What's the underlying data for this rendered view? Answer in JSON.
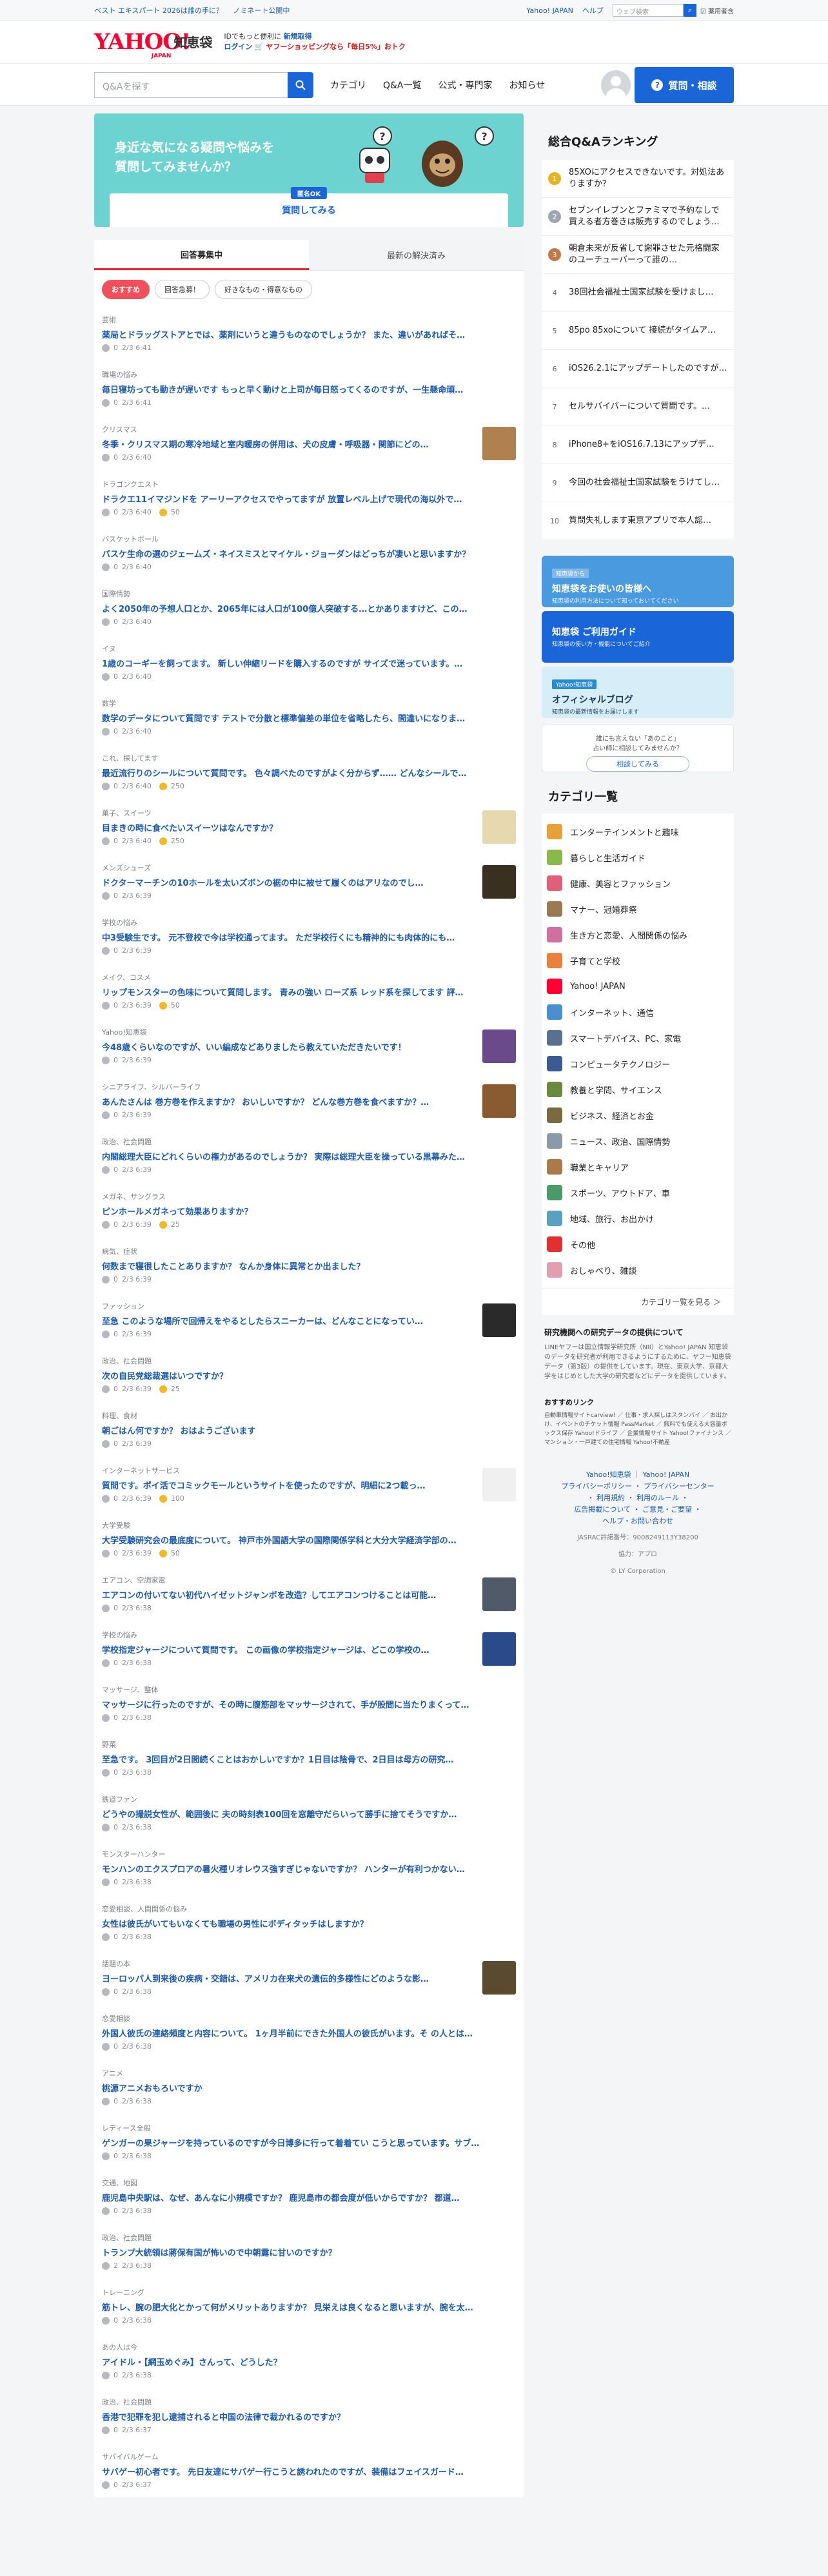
{
  "topbar": {
    "links": [
      "ベスト エキスパート 2026は誰の手に？",
      "ノミネート公開中"
    ],
    "right": [
      "Yahoo! JAPAN",
      "ヘルプ"
    ],
    "websearch_placeholder": "ウェブ検索",
    "websearch_scope": "☑ 薬用者含"
  },
  "header": {
    "logo": "YAHOO!",
    "logo_sub": "JAPAN",
    "service": "知恵袋",
    "promo_line1": "IDでもっと便利に",
    "promo_new": "新規取得",
    "promo_login": "ログイン",
    "promo_line2": "🛒 ヤフーショッピングなら「毎日5%」おトク"
  },
  "nav": {
    "search_placeholder": "Q&Aを探す",
    "links": [
      "カテゴリ",
      "Q&A一覧",
      "公式・専門家",
      "お知らせ"
    ],
    "ask_label": "質問・相談"
  },
  "banner": {
    "line1": "身近な気になる疑問や悩みを",
    "line2": "質問してみませんか？",
    "tag": "匿名OK",
    "button": "質問してみる"
  },
  "tabs": [
    "回答募集中",
    "最新の解決済み"
  ],
  "filters": [
    "おすすめ",
    "回答急募！",
    "好きなもの・得意なもの"
  ],
  "questions": [
    {
      "cat": "芸術",
      "title": "薬局とドラッグストアとでは、薬剤にいうと違うものなのでしょうか？ また、違いがあればそ…",
      "ans": "0",
      "time": "2/3 6:41",
      "coin": ""
    },
    {
      "cat": "職場の悩み",
      "title": "毎日寝坊っても動きが遅いです もっと早く動けと上司が毎日怒ってくるのですが、一生懸命頑…",
      "ans": "0",
      "time": "2/3 6:41",
      "coin": ""
    },
    {
      "cat": "クリスマス",
      "title": "冬季・クリスマス期の寒冷地域と室内暖房の併用は、犬の皮膚・呼吸器・関節にどの…",
      "ans": "0",
      "time": "2/3 6:40",
      "coin": "",
      "thumb": "#b08050"
    },
    {
      "cat": "ドラゴンクエスト",
      "title": "ドラクエ11イマジンドを アーリーアクセスでやってますが 放置レベル上げで現代の海以外で…",
      "ans": "0",
      "time": "2/3 6:40",
      "coin": "50"
    },
    {
      "cat": "バスケットボール",
      "title": "バスケ生命の選のジェームズ・ネイスミスとマイケル・ジョーダンはどっちが凄いと思いますか？",
      "ans": "0",
      "time": "2/3 6:40",
      "coin": ""
    },
    {
      "cat": "国際情勢",
      "title": "よく2050年の予想人口とか、2065年には人口が100億人突破する…とかありますけど、この…",
      "ans": "0",
      "time": "2/3 6:40",
      "coin": ""
    },
    {
      "cat": "イヌ",
      "title": "1歳のコーギーを飼ってます。 新しい伸縮リードを購入するのですが サイズで迷っています。…",
      "ans": "0",
      "time": "2/3 6:40",
      "coin": ""
    },
    {
      "cat": "数学",
      "title": "数学のデータについて質問です テストで分散と標準偏差の単位を省略したら、間違いになりま…",
      "ans": "0",
      "time": "2/3 6:40",
      "coin": ""
    },
    {
      "cat": "これ、探してます",
      "title": "最近流行りのシールについて質問です。 色々調べたのですがよく分からず…… どんなシールで…",
      "ans": "0",
      "time": "2/3 6:40",
      "coin": "250"
    },
    {
      "cat": "菓子、スイーツ",
      "title": "目まきの時に食べたいスイーツはなんですか？",
      "ans": "0",
      "time": "2/3 6:40",
      "coin": "250",
      "thumb": "#e8d8b0"
    },
    {
      "cat": "メンズシューズ",
      "title": "ドクターマーチンの10ホールを太いズボンの裾の中に被せて履くのはアリなのでし…",
      "ans": "0",
      "time": "2/3 6:39",
      "coin": "",
      "thumb": "#3a3020"
    },
    {
      "cat": "学校の悩み",
      "title": "中3受験生です。 元不登校で今は学校通ってます。 ただ学校行くにも精神的にも肉体的にも…",
      "ans": "0",
      "time": "2/3 6:39",
      "coin": ""
    },
    {
      "cat": "メイク、コスメ",
      "title": "リップモンスターの色味について質問します。 青みの強い ローズ系 レッド系を探してます 評…",
      "ans": "0",
      "time": "2/3 6:39",
      "coin": "50"
    },
    {
      "cat": "Yahoo!知恵袋",
      "title": "今48歳くらいなのですが、いい編成などありましたら教えていただきたいです！",
      "ans": "0",
      "time": "2/3 6:39",
      "coin": "",
      "thumb": "#6a4a8a"
    },
    {
      "cat": "シニアライフ、シルバーライフ",
      "title": "あんたさんは 巻方巻を作えますか？ おいしいですか？ どんな巻方巻を食べますか？…",
      "ans": "0",
      "time": "2/3 6:39",
      "coin": "",
      "thumb": "#8a5a30"
    },
    {
      "cat": "政治、社会問題",
      "title": "内閣総理大臣にどれくらいの権力があるのでしょうか？ 実際は総理大臣を操っている黒幕みた…",
      "ans": "0",
      "time": "2/3 6:39",
      "coin": ""
    },
    {
      "cat": "メガネ、サングラス",
      "title": "ピンホールメガネって効果ありますか？",
      "ans": "0",
      "time": "2/3 6:39",
      "coin": "25"
    },
    {
      "cat": "病気、症状",
      "title": "何数まで寝很したことありますか？ なんか身体に異常とか出ました？",
      "ans": "0",
      "time": "2/3 6:39",
      "coin": ""
    },
    {
      "cat": "ファッション",
      "title": "至急 このような場所で回帰えをやるとしたらスニーカーは、どんなことになってい…",
      "ans": "0",
      "time": "2/3 6:39",
      "coin": "",
      "thumb": "#2a2a2a"
    },
    {
      "cat": "政治、社会問題",
      "title": "次の自民党総裁選はいつですか？",
      "ans": "0",
      "time": "2/3 6:39",
      "coin": "25"
    },
    {
      "cat": "料理、食材",
      "title": "朝ごはん何ですか？ おはようございます",
      "ans": "0",
      "time": "2/3 6:39",
      "coin": ""
    },
    {
      "cat": "インターネットサービス",
      "title": "質問です。ポイ活でコミックモールというサイトを使ったのですが、明細に2つ載っ…",
      "ans": "0",
      "time": "2/3 6:39",
      "coin": "100",
      "thumb": "#f0f0f0"
    },
    {
      "cat": "大学受験",
      "title": "大学受験研究会の最底度について。 神戸市外国語大学の国際関係学科と大分大学経済学部の…",
      "ans": "0",
      "time": "2/3 6:39",
      "coin": "50"
    },
    {
      "cat": "エアコン、空調家電",
      "title": "エアコンの付いてない初代ハイゼットジャンボを改造？してエアコンつけることは可能…",
      "ans": "0",
      "time": "2/3 6:38",
      "coin": "",
      "thumb": "#505a68"
    },
    {
      "cat": "学校の悩み",
      "title": "学校指定ジャージについて質問です。 この画像の学校指定ジャージは、どこの学校の…",
      "ans": "0",
      "time": "2/3 6:38",
      "coin": "",
      "thumb": "#2a4a8a"
    },
    {
      "cat": "マッサージ、整体",
      "title": "マッサージに行ったのですが、その時に腹筋部をマッサージされて、手が股間に当たりまくって…",
      "ans": "0",
      "time": "2/3 6:38",
      "coin": ""
    },
    {
      "cat": "野菜",
      "title": "至急です。 3回目が2日間続くことはおかしいですか？1日目は陰骨で、2日目は母方の研究…",
      "ans": "0",
      "time": "2/3 6:38",
      "coin": ""
    },
    {
      "cat": "鉄道ファン",
      "title": "どうやの撮説女性が、範囲後に 夫の時刻表100回を窓離守だらいって勝手に捨てそうですか…",
      "ans": "0",
      "time": "2/3 6:38",
      "coin": ""
    },
    {
      "cat": "モンスターハンター",
      "title": "モンハンのエクスプロアの暑火種リオレウス強すぎじゃないですか？ ハンターが有利つかない…",
      "ans": "0",
      "time": "2/3 6:38",
      "coin": ""
    },
    {
      "cat": "恋愛相談、人間関係の悩み",
      "title": "女性は彼氏がいてもいなくても職場の男性にボディタッチはしますか？",
      "ans": "0",
      "time": "2/3 6:38",
      "coin": ""
    },
    {
      "cat": "話題の本",
      "title": "ヨーロッパ人到来後の疾病・交錯は、アメリカ在来犬の遺伝的多様性にどのような影…",
      "ans": "0",
      "time": "2/3 6:38",
      "coin": "",
      "thumb": "#5a4a30"
    },
    {
      "cat": "恋愛相談",
      "title": "外国人彼氏の連絡頻度と内容について。 1ヶ月半前にできた外国人の彼氏がいます。そ の人とは…",
      "ans": "0",
      "time": "2/3 6:38",
      "coin": ""
    },
    {
      "cat": "アニメ",
      "title": "桃源アニメおもろいですか",
      "ans": "0",
      "time": "2/3 6:38",
      "coin": ""
    },
    {
      "cat": "レディース全般",
      "title": "ゲンガーの果ジャージを持っているのですが今日博多に行って着着てい こうと思っています。サブ…",
      "ans": "0",
      "time": "2/3 6:38",
      "coin": ""
    },
    {
      "cat": "交通、地図",
      "title": "鹿児島中央駅は、なぜ、あんなに小規模ですか？ 鹿児島市の都会度が低いからですか？ 都道…",
      "ans": "0",
      "time": "2/3 6:38",
      "coin": ""
    },
    {
      "cat": "政治、社会問題",
      "title": "トランプ大統領は蔣保有国が怖いので中朝露に甘いのですか？",
      "ans": "2",
      "time": "2/3 6:38",
      "coin": ""
    },
    {
      "cat": "トレーニング",
      "title": "筋トレ、腕の肥大化とかって何がメリットありますか？ 見栄えは良くなると思いますが、腕を太…",
      "ans": "0",
      "time": "2/3 6:38",
      "coin": ""
    },
    {
      "cat": "あの人は今",
      "title": "アイドル・【網玉めぐみ】さんって、どうした？",
      "ans": "0",
      "time": "2/3 6:38",
      "coin": ""
    },
    {
      "cat": "政治、社会問題",
      "title": "香港で犯罪を犯し逮捕されると中国の法律で裁かれるのですか？",
      "ans": "0",
      "time": "2/3 6:37",
      "coin": ""
    },
    {
      "cat": "サバイバルゲーム",
      "title": "サバゲー初心者です。 先日友達にサバゲー行こうと誘われたのですが、装備はフェイスガード…",
      "ans": "0",
      "time": "2/3 6:37",
      "coin": ""
    }
  ],
  "ranking": {
    "title": "総合Q&Aランキング",
    "items": [
      "85XOにアクセスできないです。対処法ありますか？",
      "セブンイレブンとファミマで予約なしで買える者方巻きは販売するのでしょうか？",
      "朝倉未来が反省して謝罪させた元格闘家のユーチューバーって誰の…",
      "38回社会福祉士国家試験を受けまし…",
      "85po 85xoについて 接続がタイムア…",
      "iOS26.2.1にアップデートしたのですが…",
      "セルサバイバーについて質問です。…",
      "iPhone8+をiOS16.7.13にアップデ…",
      "今回の社会福祉士国家試験をうけてし…",
      "質問失礼します東京アプリで本人認…"
    ]
  },
  "ads": [
    {
      "l1": "知恵袋から",
      "l2": "知恵袋をお使いの皆様へ",
      "l3": "知恵袋の利用方法について知っておいてください"
    },
    {
      "l1": "",
      "l2": "知恵袋 ご利用ガイド",
      "l3": "知恵袋の使い方・機能についてご紹介"
    },
    {
      "l1": "Yahoo!知恵袋",
      "l2": "オフィシャルブログ",
      "l3": "知恵袋の最新情報をお届けします"
    }
  ],
  "askcard": {
    "l1": "誰にも言えない「あのこと」",
    "l2": "占い師に相談してみませんか？",
    "btn": "相談してみる"
  },
  "categories": {
    "title": "カテゴリ一覧",
    "items": [
      {
        "label": "エンターテインメントと趣味",
        "color": "#e8a03a"
      },
      {
        "label": "暮らしと生活ガイド",
        "color": "#8ab84a"
      },
      {
        "label": "健康、美容とファッション",
        "color": "#e0607a"
      },
      {
        "label": "マナー、冠婚葬祭",
        "color": "#9a7a50"
      },
      {
        "label": "生き方と恋愛、人間関係の悩み",
        "color": "#d070a0"
      },
      {
        "label": "子育てと学校",
        "color": "#e88040"
      },
      {
        "label": "Yahoo! JAPAN",
        "color": "#ff0033"
      },
      {
        "label": "インターネット、通信",
        "color": "#4a90d0"
      },
      {
        "label": "スマートデバイス、PC、家電",
        "color": "#5a7090"
      },
      {
        "label": "コンピュータテクノロジー",
        "color": "#3a5a90"
      },
      {
        "label": "教養と学問、サイエンス",
        "color": "#6a8a40"
      },
      {
        "label": "ビジネス、経済とお金",
        "color": "#7a6a40"
      },
      {
        "label": "ニュース、政治、国際情勢",
        "color": "#8a9aaa"
      },
      {
        "label": "職業とキャリア",
        "color": "#aa7a4a"
      },
      {
        "label": "スポーツ、アウトドア、車",
        "color": "#4a9a6a"
      },
      {
        "label": "地域、旅行、お出かけ",
        "color": "#5aa0c0"
      },
      {
        "label": "その他",
        "color": "#e03030"
      },
      {
        "label": "おしゃべり、雑談",
        "color": "#e0a0b0"
      }
    ],
    "more": "カテゴリー覧を見る ＞"
  },
  "research": {
    "title": "研究機関への研究データの提供について",
    "body": "LINEヤフーは国立情報学研究所（NII）とYahoo! JAPAN 知恵袋のデータを研究者が利用できるようにするために、ヤフー知恵袋データ（第3版）の提供をしています。現在、東京大学、京都大学をはじめとした大学の研究者などにデータを提供しています。"
  },
  "links": {
    "title": "おすすめリンク",
    "body": "自動車情報サイトcarview! ／ 仕事・求人探しはスタンバイ ／ お出かけ、イベントのチケット情報 PassMarket ／ 無料でも使える大容量ボックス保存 Yahoo!ドライブ ／ 企業情報サイト Yahoo!ファイナンス ／ マンション・一戸建ての住宅情報 Yahoo!不動産"
  },
  "footer": {
    "l1": "Yahoo!知恵袋 ｜ Yahoo! JAPAN",
    "l2": "プライバシーポリシー ・ プライバシーセンター",
    "l3": "・ 利用規約 ・ 利用のルール ・",
    "l4": "広告掲載について ・ ご意見・ご要望 ・",
    "l5": "ヘルプ・お問い合わせ",
    "g1": "JASRAC許諾番号：9008249113Y38200",
    "g2": "協力：アプロ",
    "g3": "© LY Corporation"
  }
}
